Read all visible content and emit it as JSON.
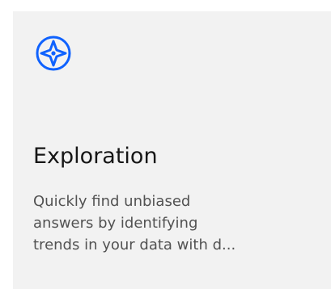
{
  "tile": {
    "icon": "compass-icon",
    "title": "Exploration",
    "description": "Quickly find unbiased\nanswers by identifying\ntrends in your data with d..."
  },
  "colors": {
    "tile_background": "#f2f2f2",
    "icon_accent": "#0f62fe",
    "title_text": "#161616",
    "description_text": "#525252"
  }
}
